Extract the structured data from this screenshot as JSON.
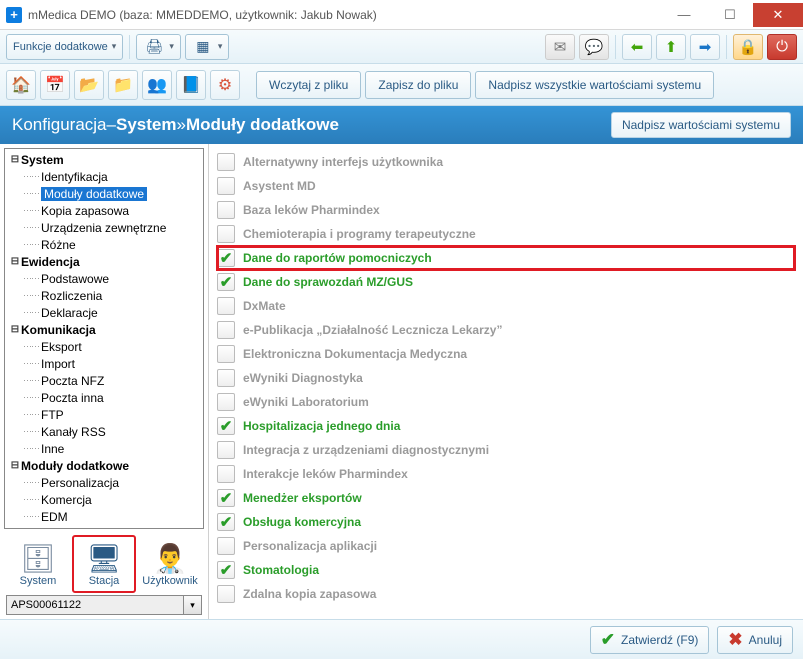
{
  "window": {
    "title": "mMedica DEMO  (baza: MMEDDEMO, użytkownik: Jakub Nowak)",
    "app_icon_text": "+"
  },
  "toolbar1": {
    "funkcje_label": "Funkcje dodatkowe"
  },
  "toolbar2": {
    "wczytaj": "Wczytaj z pliku",
    "zapisz": "Zapisz do pliku",
    "nadpisz_all": "Nadpisz wszystkie wartościami systemu"
  },
  "breadcrumb": {
    "a": "Konfiguracja",
    "sep1": " – ",
    "b": "System",
    "sep2": " » ",
    "c": "Moduły dodatkowe",
    "nadpisz_btn": "Nadpisz wartościami systemu"
  },
  "tree": [
    {
      "label": "System",
      "level": 0,
      "bold": true,
      "toggle": "⊟"
    },
    {
      "label": "Identyfikacja",
      "level": 1
    },
    {
      "label": "Moduły dodatkowe",
      "level": 1,
      "selected": true
    },
    {
      "label": "Kopia zapasowa",
      "level": 1
    },
    {
      "label": "Urządzenia zewnętrzne",
      "level": 1
    },
    {
      "label": "Różne",
      "level": 1
    },
    {
      "label": "Ewidencja",
      "level": 0,
      "bold": true,
      "toggle": "⊟"
    },
    {
      "label": "Podstawowe",
      "level": 1
    },
    {
      "label": "Rozliczenia",
      "level": 1
    },
    {
      "label": "Deklaracje",
      "level": 1
    },
    {
      "label": "Komunikacja",
      "level": 0,
      "bold": true,
      "toggle": "⊟"
    },
    {
      "label": "Eksport",
      "level": 1
    },
    {
      "label": "Import",
      "level": 1
    },
    {
      "label": "Poczta NFZ",
      "level": 1
    },
    {
      "label": "Poczta inna",
      "level": 1
    },
    {
      "label": "FTP",
      "level": 1
    },
    {
      "label": "Kanały RSS",
      "level": 1
    },
    {
      "label": "Inne",
      "level": 1
    },
    {
      "label": "Moduły dodatkowe",
      "level": 0,
      "bold": true,
      "toggle": "⊟"
    },
    {
      "label": "Personalizacja",
      "level": 1
    },
    {
      "label": "Komercja",
      "level": 1
    },
    {
      "label": "EDM",
      "level": 1
    }
  ],
  "side_icons": {
    "system": "System",
    "stacja": "Stacja",
    "uzytkownik": "Użytkownik"
  },
  "station_value": "APS00061122",
  "options": [
    {
      "label": "Alternatywny interfejs użytkownika",
      "on": false
    },
    {
      "label": "Asystent MD",
      "on": false
    },
    {
      "label": "Baza leków Pharmindex",
      "on": false
    },
    {
      "label": "Chemioterapia i programy terapeutyczne",
      "on": false
    },
    {
      "label": "Dane do raportów pomocniczych",
      "on": true,
      "highlight": true
    },
    {
      "label": "Dane do sprawozdań MZ/GUS",
      "on": true
    },
    {
      "label": "DxMate",
      "on": false
    },
    {
      "label": "e-Publikacja „Działalność Lecznicza Lekarzy”",
      "on": false
    },
    {
      "label": "Elektroniczna Dokumentacja Medyczna",
      "on": false
    },
    {
      "label": "eWyniki Diagnostyka",
      "on": false
    },
    {
      "label": "eWyniki Laboratorium",
      "on": false
    },
    {
      "label": "Hospitalizacja jednego dnia",
      "on": true
    },
    {
      "label": "Integracja z urządzeniami diagnostycznymi",
      "on": false
    },
    {
      "label": "Interakcje leków Pharmindex",
      "on": false
    },
    {
      "label": "Menedżer eksportów",
      "on": true
    },
    {
      "label": "Obsługa komercyjna",
      "on": true
    },
    {
      "label": "Personalizacja aplikacji",
      "on": false
    },
    {
      "label": "Stomatologia",
      "on": true
    },
    {
      "label": "Zdalna kopia zapasowa",
      "on": false
    }
  ],
  "footer": {
    "zatwierdz": "Zatwierdź (F9)",
    "anuluj": "Anuluj"
  }
}
